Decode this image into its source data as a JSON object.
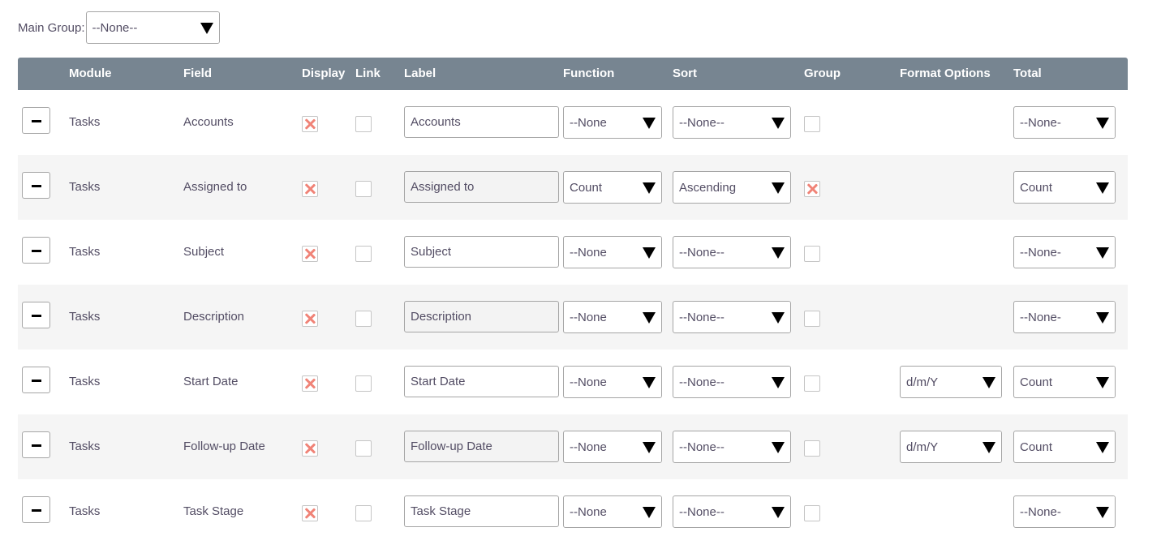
{
  "main_group": {
    "label": "Main Group:",
    "value": "--None--"
  },
  "headers": {
    "module": "Module",
    "field": "Field",
    "display": "Display",
    "link": "Link",
    "label": "Label",
    "function": "Function",
    "sort": "Sort",
    "group": "Group",
    "format_options": "Format Options",
    "total": "Total"
  },
  "rows": [
    {
      "module": "Tasks",
      "field": "Accounts",
      "display": true,
      "link": false,
      "label": "Accounts",
      "function": "--None",
      "sort": "--None--",
      "group": false,
      "format": "",
      "total": "--None-"
    },
    {
      "module": "Tasks",
      "field": "Assigned to",
      "display": true,
      "link": false,
      "label": "Assigned to",
      "function": "Count",
      "sort": "Ascending",
      "group": true,
      "format": "",
      "total": "Count"
    },
    {
      "module": "Tasks",
      "field": "Subject",
      "display": true,
      "link": false,
      "label": "Subject",
      "function": "--None",
      "sort": "--None--",
      "group": false,
      "format": "",
      "total": "--None-"
    },
    {
      "module": "Tasks",
      "field": "Description",
      "display": true,
      "link": false,
      "label": "Description",
      "function": "--None",
      "sort": "--None--",
      "group": false,
      "format": "",
      "total": "--None-"
    },
    {
      "module": "Tasks",
      "field": "Start Date",
      "display": true,
      "link": false,
      "label": "Start Date",
      "function": "--None",
      "sort": "--None--",
      "group": false,
      "format": "d/m/Y",
      "total": "Count"
    },
    {
      "module": "Tasks",
      "field": "Follow-up Date",
      "display": true,
      "link": false,
      "label": "Follow-up Date",
      "function": "--None",
      "sort": "--None--",
      "group": false,
      "format": "d/m/Y",
      "total": "Count"
    },
    {
      "module": "Tasks",
      "field": "Task Stage",
      "display": true,
      "link": false,
      "label": "Task Stage",
      "function": "--None",
      "sort": "--None--",
      "group": false,
      "format": "",
      "total": "--None-"
    }
  ]
}
